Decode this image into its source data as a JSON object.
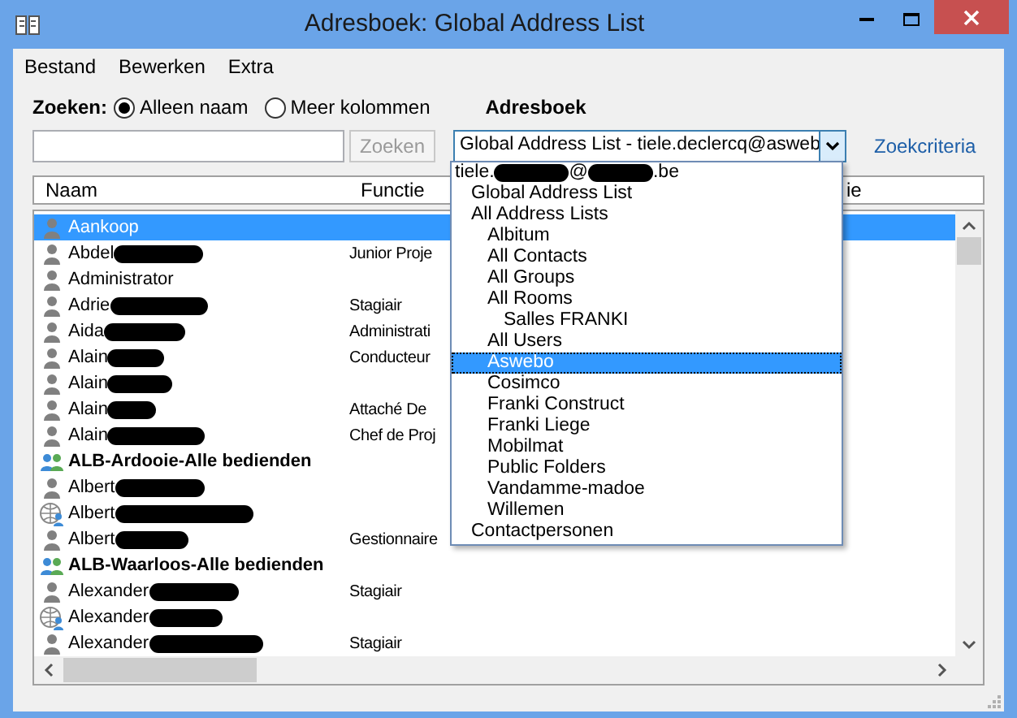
{
  "window": {
    "title": "Adresboek: Global Address List"
  },
  "menu": [
    {
      "label": "Bestand"
    },
    {
      "label": "Bewerken"
    },
    {
      "label": "Extra"
    }
  ],
  "search": {
    "label": "Zoeken:",
    "options": [
      {
        "label": "Alleen naam",
        "selected": true
      },
      {
        "label": "Meer kolommen",
        "selected": false
      }
    ],
    "button": "Zoeken"
  },
  "addressbook": {
    "label": "Adresboek",
    "value": "Global Address List - tiele.declercq@asweb",
    "criteria_link": "Zoekcriteria",
    "dropdown": [
      {
        "parts": [
          "tiele.",
          "@",
          ".be"
        ],
        "selected": false,
        "children": [
          {
            "label": "Global Address List",
            "selected": false
          },
          {
            "label": "All Address Lists",
            "selected": false,
            "children": [
              {
                "label": "Albitum",
                "selected": false
              },
              {
                "label": "All Contacts",
                "selected": false
              },
              {
                "label": "All Groups",
                "selected": false
              },
              {
                "label": "All Rooms",
                "selected": false,
                "children": [
                  {
                    "label": "Salles FRANKI",
                    "selected": false
                  }
                ]
              },
              {
                "label": "All Users",
                "selected": false
              },
              {
                "label": "Aswebo",
                "selected": true
              },
              {
                "label": "Cosimco",
                "selected": false
              },
              {
                "label": "Franki Construct",
                "selected": false
              },
              {
                "label": "Franki Liege",
                "selected": false
              },
              {
                "label": "Mobilmat",
                "selected": false
              },
              {
                "label": "Public Folders",
                "selected": false
              },
              {
                "label": "Vandamme-madoe",
                "selected": false
              },
              {
                "label": "Willemen",
                "selected": false
              }
            ]
          },
          {
            "label": "Contactpersonen",
            "selected": false
          }
        ]
      }
    ]
  },
  "table": {
    "columns": [
      "Naam",
      "Functie",
      "ie"
    ],
    "rows": [
      {
        "name": "Aankoop",
        "functie": "",
        "kind": "person",
        "redacted": false,
        "selected": true
      },
      {
        "name": "Abdel",
        "functie": "Junior Proje",
        "kind": "person",
        "redacted": true,
        "selected": false
      },
      {
        "name": "Administrator",
        "functie": "",
        "kind": "person",
        "redacted": false,
        "selected": false
      },
      {
        "name": "Adrie",
        "functie": "Stagiair",
        "kind": "person",
        "redacted": true,
        "selected": false
      },
      {
        "name": "Aida",
        "functie": "Administrati",
        "kind": "person",
        "redacted": true,
        "selected": false
      },
      {
        "name": "Alain",
        "functie": "Conducteur",
        "kind": "person",
        "redacted": true,
        "selected": false
      },
      {
        "name": "Alain",
        "functie": "",
        "kind": "person",
        "redacted": true,
        "selected": false
      },
      {
        "name": "Alain",
        "functie": "Attaché De",
        "kind": "person",
        "redacted": true,
        "selected": false
      },
      {
        "name": "Alain",
        "functie": "Chef de Proj",
        "kind": "person",
        "redacted": true,
        "selected": false
      },
      {
        "name": "ALB-Ardooie-Alle bedienden",
        "functie": "",
        "kind": "group",
        "redacted": false,
        "selected": false
      },
      {
        "name": "Albert",
        "functie": "",
        "kind": "person",
        "redacted": true,
        "selected": false
      },
      {
        "name": "Albert",
        "functie": "",
        "kind": "external",
        "redacted": true,
        "selected": false
      },
      {
        "name": "Albert",
        "functie": "Gestionnaire",
        "kind": "person",
        "redacted": true,
        "selected": false
      },
      {
        "name": "ALB-Waarloos-Alle bedienden",
        "functie": "",
        "kind": "group",
        "redacted": false,
        "selected": false
      },
      {
        "name": "Alexander",
        "functie": "Stagiair",
        "kind": "person",
        "redacted": true,
        "selected": false
      },
      {
        "name": "Alexander",
        "functie": "",
        "kind": "external",
        "redacted": true,
        "selected": false
      },
      {
        "name": "Alexander",
        "functie": "Stagiair",
        "kind": "person",
        "redacted": true,
        "selected": false
      }
    ]
  }
}
